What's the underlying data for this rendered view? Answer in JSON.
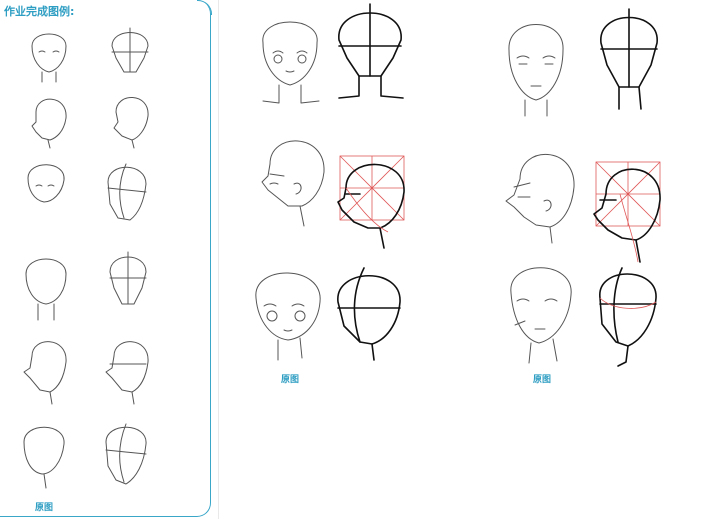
{
  "left_panel": {
    "title": "作业完成图例:",
    "caption": "原图"
  },
  "middle_panel": {
    "caption": "原图"
  },
  "right_panel": {
    "caption": "原图"
  },
  "colors": {
    "accent": "#3aa7c9",
    "guide": "#e05a5a",
    "ink": "#111111"
  }
}
